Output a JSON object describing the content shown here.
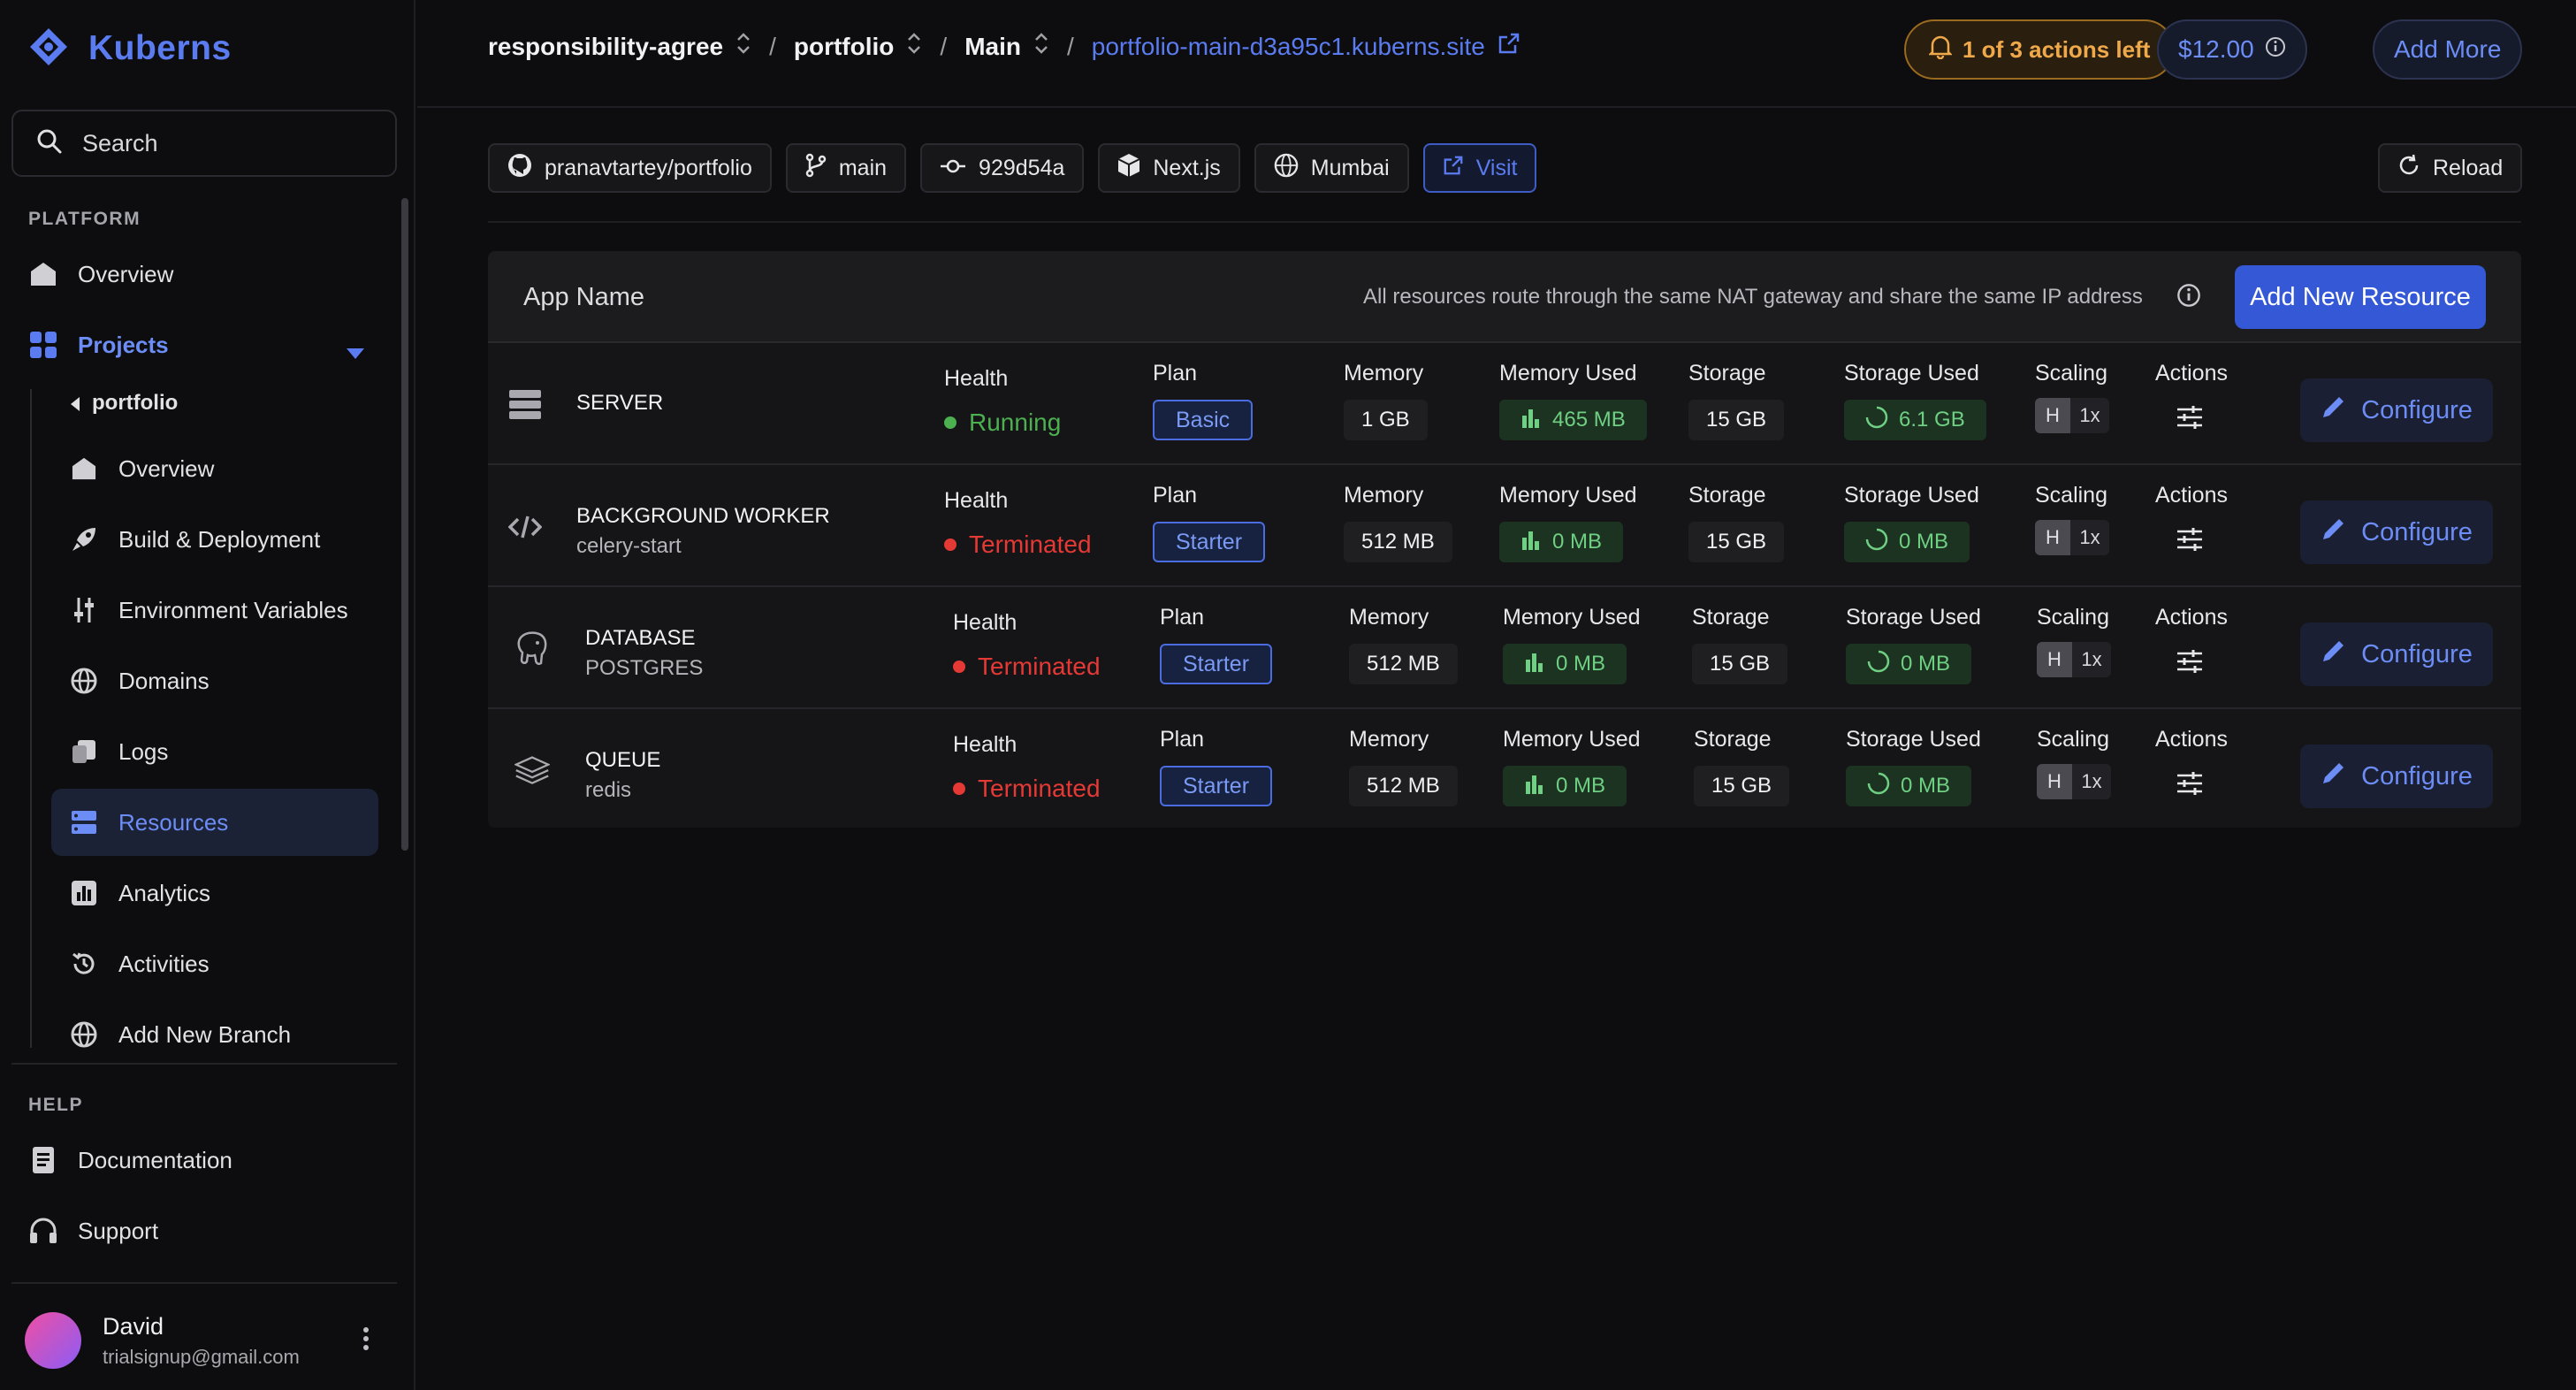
{
  "brand": {
    "name": "Kuberns"
  },
  "search": {
    "label": "Search"
  },
  "sidebar": {
    "platform_label": "PLATFORM",
    "overview": "Overview",
    "projects": "Projects",
    "project_name": "portfolio",
    "sub_items": [
      {
        "label": "Overview",
        "icon": "home-icon"
      },
      {
        "label": "Build & Deployment",
        "icon": "rocket-icon"
      },
      {
        "label": "Environment Variables",
        "icon": "sliders-icon"
      },
      {
        "label": "Domains",
        "icon": "globe-icon"
      },
      {
        "label": "Logs",
        "icon": "logs-icon"
      },
      {
        "label": "Resources",
        "icon": "server-icon"
      },
      {
        "label": "Analytics",
        "icon": "chart-icon"
      },
      {
        "label": "Activities",
        "icon": "history-icon"
      },
      {
        "label": "Add New Branch",
        "icon": "globe-icon"
      }
    ],
    "help_label": "HELP",
    "documentation": "Documentation",
    "support": "Support"
  },
  "user": {
    "name": "David",
    "email": "trialsignup@gmail.com"
  },
  "header": {
    "crumb_org": "responsibility-agree",
    "crumb_project": "portfolio",
    "crumb_branch": "Main",
    "crumb_domain": "portfolio-main-d3a95c1.kuberns.site",
    "separator": "/",
    "actions_left": "1 of 3 actions left",
    "balance": "$12.00",
    "add_more": "Add More"
  },
  "chips": {
    "repo": "pranavtartey/portfolio",
    "branch": "main",
    "commit": "929d54a",
    "framework": "Next.js",
    "region": "Mumbai",
    "visit": "Visit",
    "reload": "Reload"
  },
  "table": {
    "app_name": "App Name",
    "nat_note": "All resources route through the same NAT gateway and share the same IP address",
    "add_resource": "Add New Resource",
    "labels": {
      "health": "Health",
      "plan": "Plan",
      "memory": "Memory",
      "memory_used": "Memory Used",
      "storage": "Storage",
      "storage_used": "Storage Used",
      "scaling": "Scaling",
      "actions": "Actions",
      "configure": "Configure",
      "scale_h": "H"
    },
    "rows": [
      {
        "title": "SERVER",
        "subtitle": "",
        "health": "Running",
        "health_color": "#4caf50",
        "plan": "Basic",
        "memory": "1 GB",
        "memory_used": "465 MB",
        "storage": "15 GB",
        "storage_used": "6.1 GB",
        "scaling": "1x"
      },
      {
        "title": "BACKGROUND WORKER",
        "subtitle": "celery-start",
        "health": "Terminated",
        "health_color": "#e53935",
        "plan": "Starter",
        "memory": "512 MB",
        "memory_used": "0 MB",
        "storage": "15 GB",
        "storage_used": "0 MB",
        "scaling": "1x"
      },
      {
        "title": "DATABASE",
        "subtitle": "POSTGRES",
        "health": "Terminated",
        "health_color": "#e53935",
        "plan": "Starter",
        "memory": "512 MB",
        "memory_used": "0 MB",
        "storage": "15 GB",
        "storage_used": "0 MB",
        "scaling": "1x"
      },
      {
        "title": "QUEUE",
        "subtitle": "redis",
        "health": "Terminated",
        "health_color": "#e53935",
        "plan": "Starter",
        "memory": "512 MB",
        "memory_used": "0 MB",
        "storage": "15 GB",
        "storage_used": "0 MB",
        "scaling": "1x"
      }
    ]
  },
  "colors": {
    "accent": "#5b7cf0",
    "running": "#4caf50",
    "terminated": "#e53935",
    "warning": "#f0a94a"
  }
}
